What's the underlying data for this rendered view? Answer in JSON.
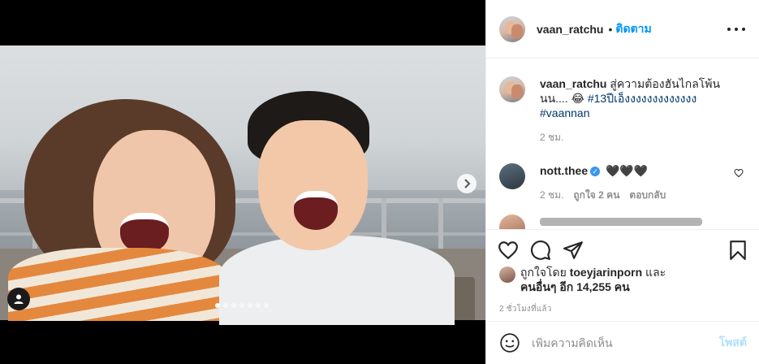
{
  "post": {
    "username": "vaan_ratchu",
    "separator": "•",
    "follow_label": "ติดตาม",
    "more_icon": "more-options-icon"
  },
  "caption": {
    "username": "vaan_ratchu",
    "text": " สู่ความต้องฮันไกลโพ้น นน.... 😂 ",
    "hashtag1": "#13ปีเอ็งงงงงงงงงงงงง",
    "hashtag2": "#vaannan",
    "time": "2 ชม."
  },
  "comments": [
    {
      "username": "nott.thee",
      "verified": true,
      "text": "🖤🖤🖤",
      "time": "2 ชม.",
      "likes": "ถูกใจ 2 คน",
      "reply_label": "ตอบกลับ"
    }
  ],
  "likes": {
    "prefix": "ถูกใจโดย ",
    "liker": "toeyjarinporn",
    "and": " และ",
    "others": "คนอื่นๆ อีก 14,255 คน"
  },
  "timestamp": "2 ชั่วโมงที่แล้ว",
  "add_comment": {
    "placeholder": "เพิ่มความคิดเห็น",
    "post_label": "โพสต์"
  },
  "carousel": {
    "count": 7,
    "active_index": 0
  },
  "colors": {
    "link_blue": "#0095f6",
    "post_disabled": "#b2dffc",
    "hashtag": "#00376b",
    "muted": "#8e8e8e"
  }
}
